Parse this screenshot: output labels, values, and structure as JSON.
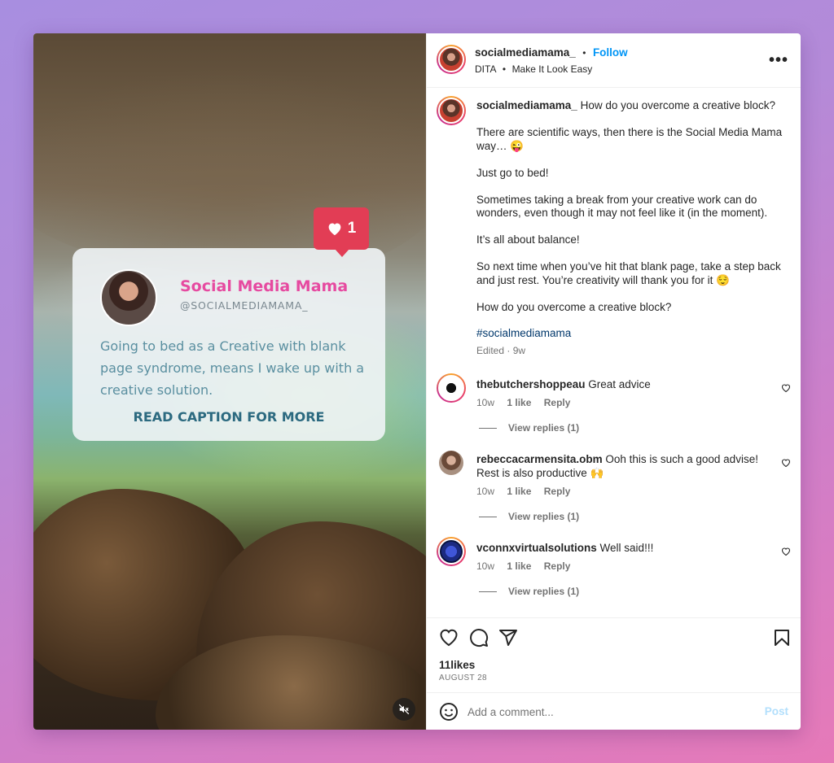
{
  "overlay": {
    "like_count": "1",
    "card_name": "Social Media Mama",
    "card_handle": "@SOCIALMEDIAMAMA_",
    "card_body": "Going to bed as a Creative with blank page syndrome, means I wake up with a creative solution.",
    "card_cta": "READ CAPTION FOR MORE"
  },
  "header": {
    "username": "socialmediamama_",
    "separator": "•",
    "follow_label": "Follow",
    "audio_artist": "DITA",
    "audio_track": "Make It Look Easy",
    "more": "•••"
  },
  "caption": {
    "username": "socialmediamama_",
    "lines": [
      "How do you overcome a creative block?",
      "There are scientific ways, then there is the Social Media Mama way… 😜",
      "Just go to bed!",
      "Sometimes taking a break from your creative work can do wonders, even though it may not feel like it (in the moment).",
      "It’s all about balance!",
      "So next time when you’ve hit that blank page, take a step back and just rest. You’re creativity will thank you for it 😌",
      "How do you overcome a creative block?"
    ],
    "hashtag": "#socialmediamama",
    "meta": "Edited · 9w"
  },
  "comments": [
    {
      "username": "thebutchershoppeau",
      "text": "Great advice",
      "age": "10w",
      "likes": "1 like",
      "reply": "Reply",
      "view_replies": "View replies (1)"
    },
    {
      "username": "rebeccacarmensita.obm",
      "text": "Ooh this is such a good advise! Rest is also productive 🙌",
      "age": "10w",
      "likes": "1 like",
      "reply": "Reply",
      "view_replies": "View replies (1)"
    },
    {
      "username": "vconnxvirtualsolutions",
      "text": "Well said!!!",
      "age": "10w",
      "likes": "1 like",
      "reply": "Reply",
      "view_replies": "View replies (1)"
    }
  ],
  "footer": {
    "likes": "11likes",
    "date": "AUGUST 28",
    "comment_placeholder": "Add a comment...",
    "post_label": "Post"
  }
}
